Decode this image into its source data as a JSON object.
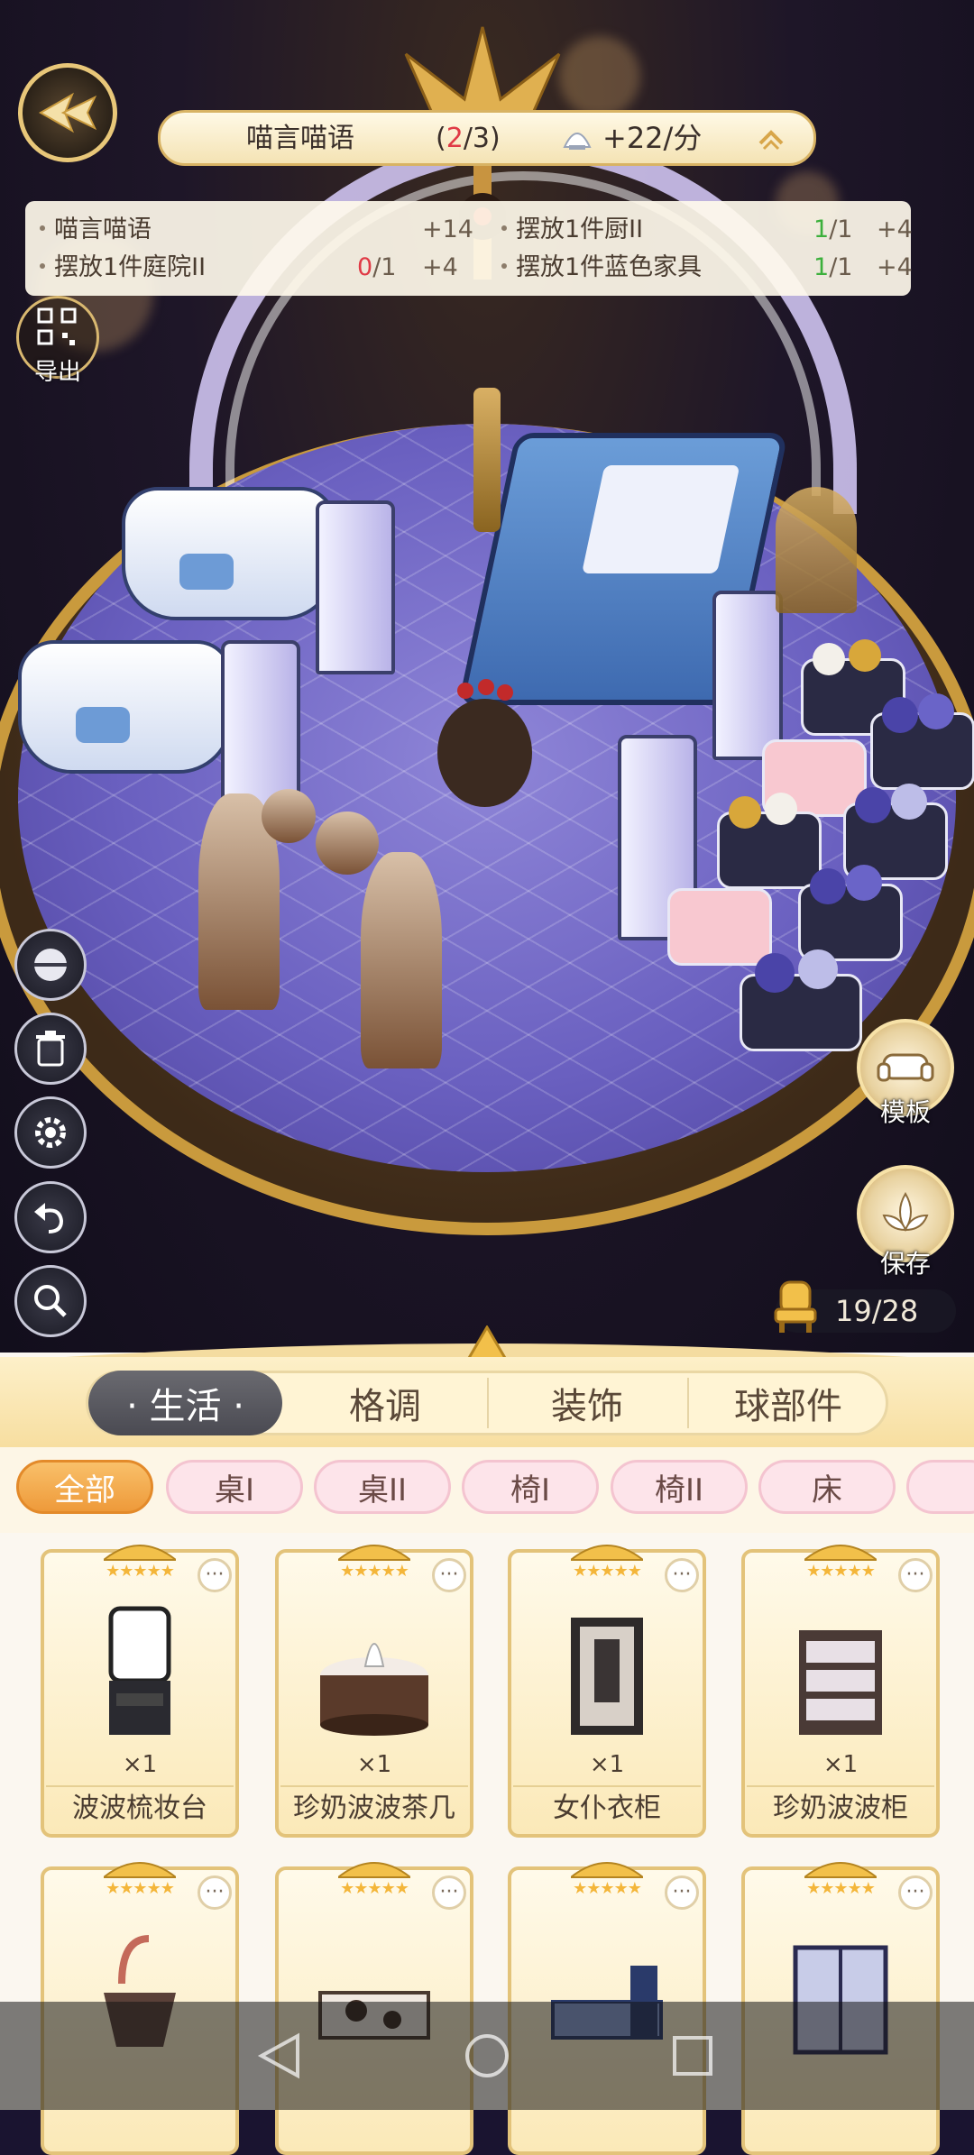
{
  "quest": {
    "title": "喵言喵语",
    "progress_open": "(",
    "progress_done": "2",
    "progress_total": "/3)",
    "rate": "+22/分"
  },
  "tasks": [
    {
      "label": "喵言喵语",
      "progress_done": "",
      "progress_total": "",
      "points": "+14",
      "done_color": ""
    },
    {
      "label": "摆放1件庭院II",
      "progress_done": "0",
      "progress_total": "/1",
      "points": "+4",
      "done_color": "red"
    },
    {
      "label": "摆放1件厨II",
      "progress_done": "1",
      "progress_total": "/1",
      "points": "+4",
      "done_color": "green"
    },
    {
      "label": "摆放1件蓝色家具",
      "progress_done": "1",
      "progress_total": "/1",
      "points": "+4",
      "done_color": "green"
    }
  ],
  "hud": {
    "export_label": "导出",
    "template_label": "模板",
    "save_label": "保存",
    "capacity": "19/28"
  },
  "left_tools": [
    {
      "name": "hide-toggle-icon"
    },
    {
      "name": "trash-icon"
    },
    {
      "name": "gear-icon"
    },
    {
      "name": "undo-icon"
    },
    {
      "name": "zoom-icon"
    }
  ],
  "categories": [
    {
      "label": "· 生活 ·",
      "active": true
    },
    {
      "label": "格调",
      "active": false
    },
    {
      "label": "装饰",
      "active": false
    },
    {
      "label": "球部件",
      "active": false
    }
  ],
  "filters": [
    {
      "label": "全部",
      "active": true
    },
    {
      "label": "桌I",
      "active": false
    },
    {
      "label": "桌II",
      "active": false
    },
    {
      "label": "椅I",
      "active": false
    },
    {
      "label": "椅II",
      "active": false
    },
    {
      "label": "床",
      "active": false
    }
  ],
  "items": [
    {
      "name": "波波梳妆台",
      "qty": "×1",
      "stars": "★★★★★",
      "more": "···"
    },
    {
      "name": "珍奶波波茶几",
      "qty": "×1",
      "stars": "★★★★★",
      "more": "···"
    },
    {
      "name": "女仆衣柜",
      "qty": "×1",
      "stars": "★★★★★",
      "more": "···"
    },
    {
      "name": "珍奶波波柜",
      "qty": "×1",
      "stars": "★★★★★",
      "more": "···"
    },
    {
      "name": "",
      "qty": "",
      "stars": "★★★★★",
      "more": "···"
    },
    {
      "name": "",
      "qty": "",
      "stars": "★★★★★",
      "more": "···"
    },
    {
      "name": "",
      "qty": "",
      "stars": "★★★★★",
      "more": "···"
    },
    {
      "name": "",
      "qty": "",
      "stars": "★★★★★",
      "more": "···"
    }
  ],
  "colors": {
    "accent_gold": "#d8b364",
    "active_tab": "#4a4a52",
    "active_chip": "#ee9a3a",
    "chip_bg": "#fde4ea",
    "floor": "#6a60c0",
    "progress_red": "#e03a46",
    "progress_green": "#3cb03c"
  }
}
